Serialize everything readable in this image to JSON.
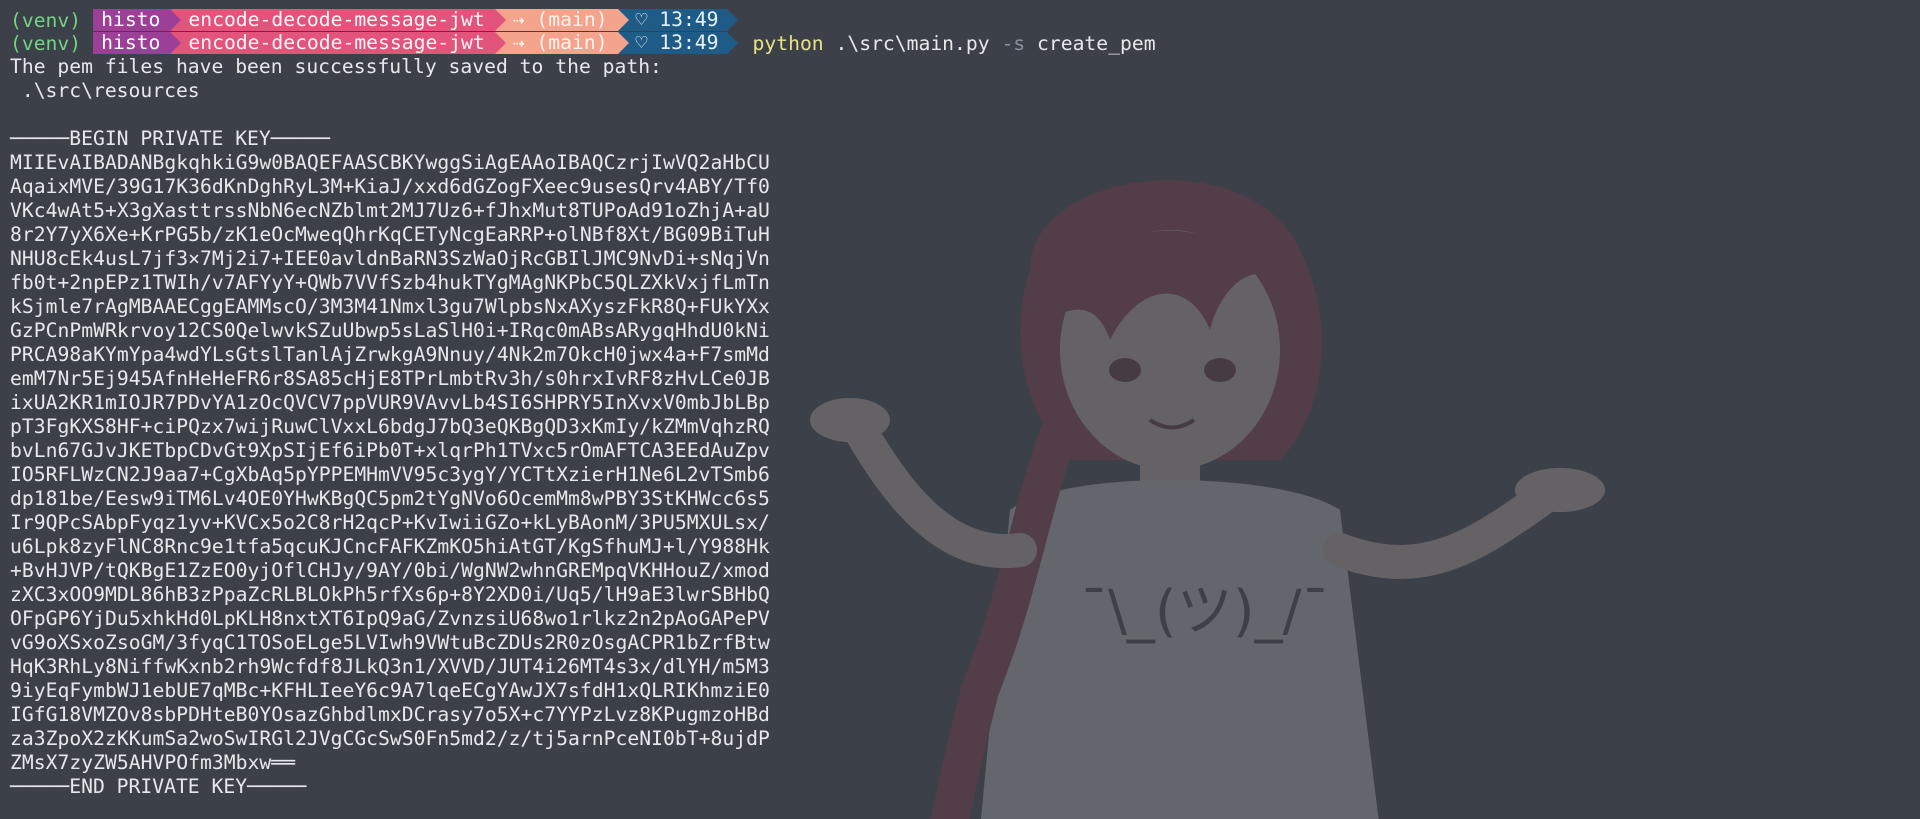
{
  "prompts": [
    {
      "venv": "(venv)",
      "user": "histo",
      "dir": "encode-decode-message-jwt",
      "git": "⇢ (main)",
      "time": "♡ 13:49",
      "command": null
    },
    {
      "venv": "(venv)",
      "user": "histo",
      "dir": "encode-decode-message-jwt",
      "git": "⇢ (main)",
      "time": "♡ 13:49",
      "command": {
        "program": "python",
        "script": " .\\src\\main.py ",
        "flag": "-s",
        "arg": " create_pem"
      }
    }
  ],
  "output": {
    "message": "The pem files have been successfully saved to the path:",
    "path": " .\\src\\resources",
    "blank": "",
    "begin": "─────BEGIN PRIVATE KEY─────",
    "key_lines": [
      "MIIEvAIBADANBgkqhkiG9w0BAQEFAASCBKYwggSiAgEAAoIBAQCzrjIwVQ2aHbCU",
      "AqaixMVE/39G17K36dKnDghRyL3M+KiaJ/xxd6dGZogFXeec9usesQrv4ABY/Tf0",
      "VKc4wAt5+X3gXasttrssNbN6ecNZblmt2MJ7Uz6+fJhxMut8TUPoAd91oZhjA+aU",
      "8r2Y7yX6Xe+KrPG5b/zK1eOcMweqQhrKqCETyNcgEaRRP+olNBf8Xt/BG09BiTuH",
      "NHU8cEk4usL7jf3×7Mj2i7+IEE0avldnBaRN3SzWaOjRcGBIlJMC9NvDi+sNqjVn",
      "fb0t+2npEPz1TWIh/v7AFYyY+QWb7VVfSzb4hukTYgMAgNKPbC5QLZXkVxjfLmTn",
      "kSjmle7rAgMBAAECggEAMMscO/3M3M41Nmxl3gu7WlpbsNxAXyszFkR8Q+FUkYXx",
      "GzPCnPmWRkrvoy12CS0QelwvkSZuUbwp5sLaSlH0i+IRqc0mABsARygqHhdU0kNi",
      "PRCA98aKYmYpa4wdYLsGtslTanlAjZrwkgA9Nnuy/4Nk2m7OkcH0jwx4a+F7smMd",
      "emM7Nr5Ej945AfnHeHeFR6r8SA85cHjE8TPrLmbtRv3h/s0hrxIvRF8zHvLCe0JB",
      "ixUA2KR1mIOJR7PDvYA1zOcQVCV7ppVUR9VAvvLb4SI6SHPRY5InXvxV0mbJbLBp",
      "pT3FgKXS8HF+ciPQzx7wijRuwClVxxL6bdgJ7bQ3eQKBgQD3xKmIy/kZMmVqhzRQ",
      "bvLn67GJvJKETbpCDvGt9XpSIjEf6iPb0T+xlqrPh1TVxc5rOmAFTCA3EEdAuZpv",
      "IO5RFLWzCN2J9aa7+CgXbAq5pYPPEMHmVV95c3ygY/YCTtXzierH1Ne6L2vTSmb6",
      "dp181be/Eesw9iTM6Lv4OE0YHwKBgQC5pm2tYgNVo6OcemMm8wPBY3StKHWcc6s5",
      "Ir9QPcSAbpFyqz1yv+KVCx5o2C8rH2qcP+KvIwiiGZo+kLyBAonM/3PU5MXULsx/",
      "u6Lpk8zyFlNC8Rnc9e1tfa5qcuKJCncFAFKZmKO5hiAtGT/KgSfhuMJ+l/Y988Hk",
      "+BvHJVP/tQKBgE1ZzEO0yjOflCHJy/9AY/0bi/WgNW2whnGREMpqVKHHouZ/xmod",
      "zXC3xOO9MDL86hB3zPpaZcRLBLOkPh5rfXs6p+8Y2XD0i/Uq5/lH9aE3lwrSBHbQ",
      "OFpGP6YjDu5xhkHd0LpKLH8nxtXT6IpQ9aG/ZvnzsiU68wo1rlkz2n2pAoGAPePV",
      "vG9oXSxoZsoGM/3fyqC1TOSoELge5LVIwh9VWtuBcZDUs2R0zOsgACPR1bZrfBtw",
      "HqK3RhLy8NiffwKxnb2rh9Wcfdf8JLkQ3n1/XVVD/JUT4i26MT4s3x/dlYH/m5M3",
      "9iyEqFymbWJ1ebUE7qMBc+KFHLIeeY6c9A7lqeECgYAwJX7sfdH1xQLRIKhmziE0",
      "IGfG18VMZOv8sbPDHteB0YOsazGhbdlmxDCrasy7o5X+c7YYPzLvz8KPugmzoHBd",
      "za3ZpoX2zKKumSa2woSwIRGl2JVgCGcSwS0Fn5md2/z/tj5arnPceNI0bT+8ujdP",
      "ZMsX7zyZW5AHVPOfm3Mbxw══"
    ],
    "end": "─────END PRIVATE KEY─────"
  },
  "colors": {
    "background": "#3c4048",
    "venv": "#73d483",
    "segment_user": "#9c3f97",
    "segment_dir": "#e2547a",
    "segment_git": "#f4a38c",
    "segment_time": "#1e5b87",
    "python": "#e8e38a",
    "flag": "#8b919b"
  }
}
